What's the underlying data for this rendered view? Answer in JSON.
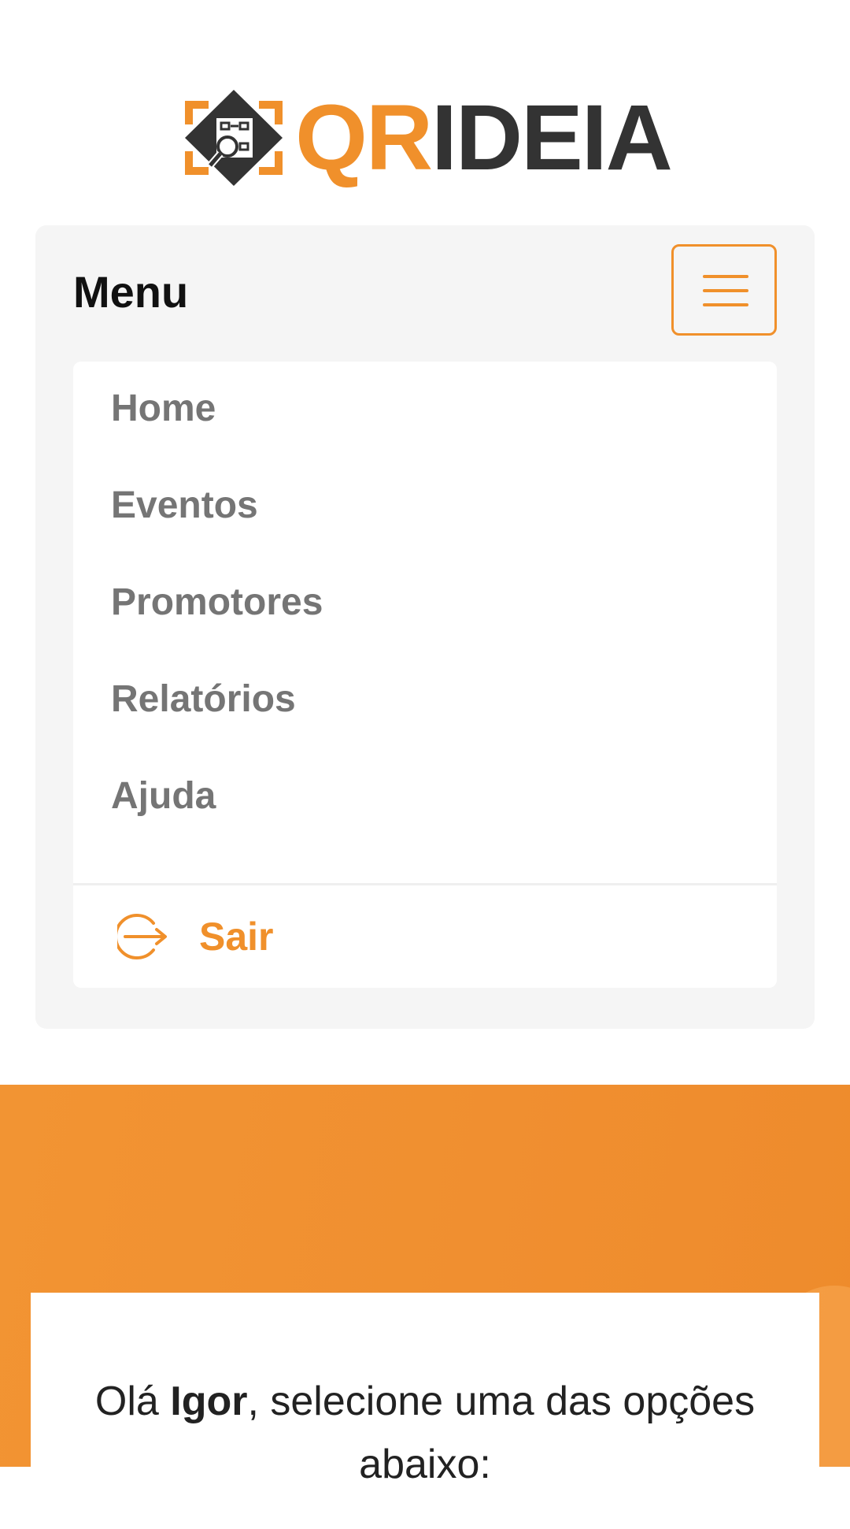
{
  "logo": {
    "text_qr": "QR",
    "text_ideia": "IDEIA",
    "brand_orange": "#f0902b",
    "brand_dark": "#333333"
  },
  "menu": {
    "title": "Menu",
    "toggle_icon": "hamburger-icon",
    "items": [
      {
        "label": "Home"
      },
      {
        "label": "Eventos"
      },
      {
        "label": "Promotores"
      },
      {
        "label": "Relatórios"
      },
      {
        "label": "Ajuda"
      }
    ],
    "logout": {
      "label": "Sair",
      "icon": "logout-icon"
    }
  },
  "greeting": {
    "prefix": "Olá ",
    "name": "Igor",
    "suffix": ", selecione uma das opções abaixo:"
  }
}
